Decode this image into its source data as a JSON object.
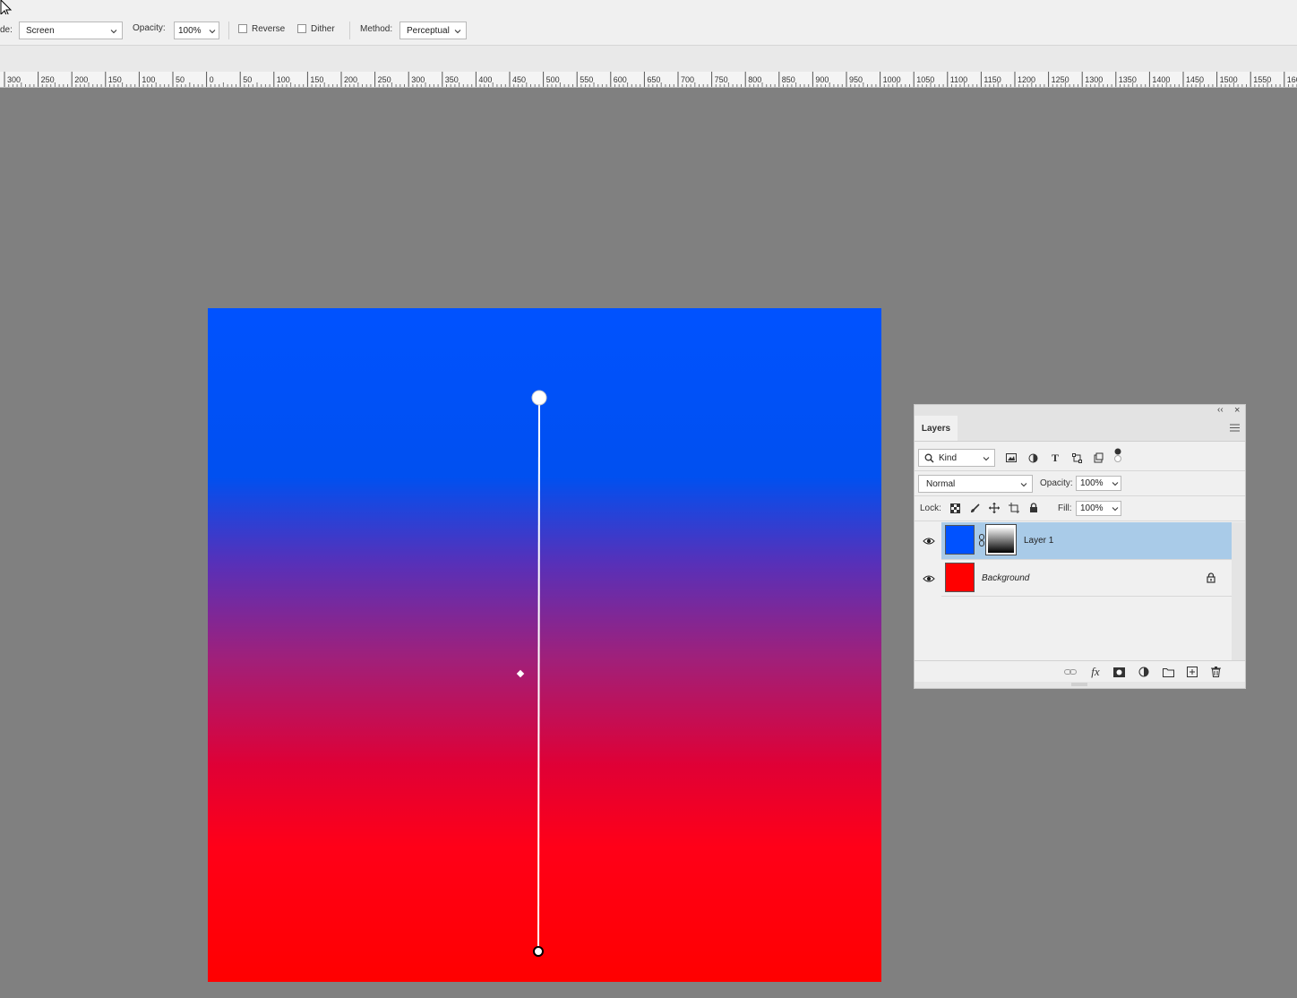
{
  "options_bar": {
    "mode_label": "de:",
    "mode_value": "Screen",
    "opacity_label": "Opacity:",
    "opacity_value": "100%",
    "reverse_label": "Reverse",
    "dither_label": "Dither",
    "method_label": "Method:",
    "method_value": "Perceptual"
  },
  "ruler": {
    "labels": [
      "300",
      "250",
      "200",
      "150",
      "100",
      "50",
      "0",
      "50",
      "100",
      "150",
      "200",
      "250",
      "300",
      "350",
      "400",
      "450",
      "500",
      "550",
      "600",
      "650",
      "700",
      "750",
      "800",
      "850",
      "900",
      "950",
      "1000",
      "1050",
      "1100",
      "1150",
      "1200",
      "1250",
      "1300",
      "1350",
      "1400",
      "1450",
      "1500",
      "1550",
      "160"
    ]
  },
  "canvas": {
    "top_color": "#0052ff",
    "bottom_color": "#ff0000"
  },
  "layers_panel": {
    "collapse_glyph": "‹‹",
    "close_glyph": "×",
    "tab_label": "Layers",
    "filter_kind": "Kind",
    "blend_mode": "Normal",
    "opacity_label": "Opacity:",
    "opacity_value": "100%",
    "lock_label": "Lock:",
    "fill_label": "Fill:",
    "fill_value": "100%",
    "layers": [
      {
        "name": "Layer 1",
        "thumb_color": "#0052ff",
        "selected": true,
        "has_mask": true
      },
      {
        "name": "Background",
        "thumb_color": "#ff0000",
        "selected": false,
        "locked": true
      }
    ],
    "footer_fx": "fx"
  }
}
